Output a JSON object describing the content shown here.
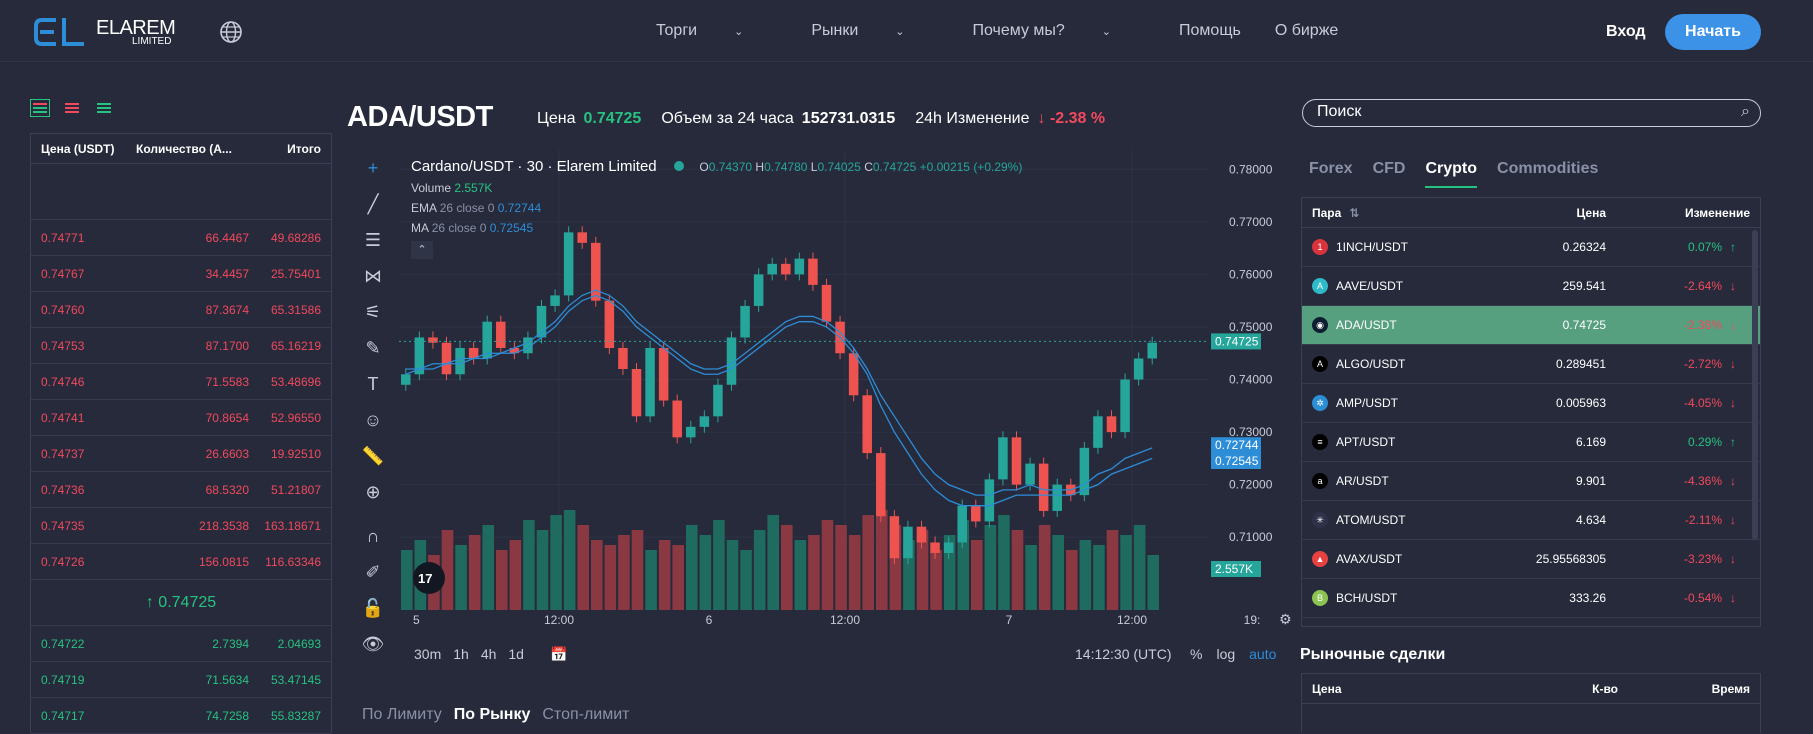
{
  "header": {
    "logo_main": "ELAREM",
    "logo_sub": "LIMITED",
    "nav": [
      "Торги",
      "Рынки",
      "Почему мы?",
      "Помощь",
      "О бирже"
    ],
    "login": "Вход",
    "start": "Начать"
  },
  "orderbook": {
    "headers": [
      "Цена (USDT)",
      "Количество (A...",
      "Итого"
    ],
    "asks": [
      [
        "0.74771",
        "66.4467",
        "49.68286"
      ],
      [
        "0.74767",
        "34.4457",
        "25.75401"
      ],
      [
        "0.74760",
        "87.3674",
        "65.31586"
      ],
      [
        "0.74753",
        "87.1700",
        "65.16219"
      ],
      [
        "0.74746",
        "71.5583",
        "53.48696"
      ],
      [
        "0.74741",
        "70.8654",
        "52.96550"
      ],
      [
        "0.74737",
        "26.6603",
        "19.92510"
      ],
      [
        "0.74736",
        "68.5320",
        "51.21807"
      ],
      [
        "0.74735",
        "218.3538",
        "163.18671"
      ],
      [
        "0.74726",
        "156.0815",
        "116.63346"
      ]
    ],
    "mid_price": "↑ 0.74725",
    "bids": [
      [
        "0.74722",
        "2.7394",
        "2.04693"
      ],
      [
        "0.74719",
        "71.5634",
        "53.47145"
      ],
      [
        "0.74717",
        "74.7258",
        "55.83287"
      ]
    ]
  },
  "ticker": {
    "pair": "ADA/USDT",
    "price_label": "Цена",
    "price": "0.74725",
    "volume_label": "Объем за 24 часа",
    "volume": "152731.0315",
    "change_label": "24h Изменение",
    "change": "↓ -2.38 %"
  },
  "chart_legend": {
    "title": "Cardano/USDT · 30 · Elarem Limited",
    "ohlc": [
      "O",
      "0.74370",
      "H",
      "0.74780",
      "L",
      "0.74025",
      "C",
      "0.74725",
      "+0.00215 (+0.29%)"
    ],
    "volume_label": "Volume",
    "volume_value": "2.557K",
    "ema_label": "EMA",
    "ema_params": "26 close 0",
    "ema_value": "0.72744",
    "ma_label": "MA",
    "ma_params": "26 close 0",
    "ma_value": "0.72545"
  },
  "chart_data": {
    "type": "line",
    "title": "Cardano/USDT · 30 · Elarem Limited",
    "ylim": [
      0.703,
      0.781
    ],
    "y_ticks": [
      "0.78000",
      "0.77000",
      "0.76000",
      "0.75000",
      "0.74000",
      "0.73000",
      "0.72000",
      "0.71000"
    ],
    "x_ticks": [
      "5",
      "12:00",
      "6",
      "12:00",
      "7",
      "12:00",
      "19:"
    ],
    "last_price_label": "0.74725",
    "ema_label": "0.72744",
    "ma_label": "0.72545",
    "volume_label": "2.557K",
    "series": [
      {
        "values": [
          0.741,
          0.748,
          0.747,
          0.741,
          0.746,
          0.744,
          0.751,
          0.746,
          0.745,
          0.748,
          0.754,
          0.756,
          0.768,
          0.766,
          0.755,
          0.746,
          0.742,
          0.733,
          0.746,
          0.736,
          0.729,
          0.731,
          0.733,
          0.739,
          0.748,
          0.754,
          0.76,
          0.762,
          0.76,
          0.763,
          0.758,
          0.751,
          0.745,
          0.737,
          0.726,
          0.714,
          0.706,
          0.712,
          0.709,
          0.707,
          0.709,
          0.716,
          0.713,
          0.721,
          0.729,
          0.72,
          0.724,
          0.715,
          0.72,
          0.718,
          0.727,
          0.733,
          0.73,
          0.74,
          0.744,
          0.747
        ]
      },
      {
        "values": [
          0.742,
          0.742,
          0.743,
          0.743,
          0.744,
          0.744,
          0.745,
          0.745,
          0.746,
          0.747,
          0.749,
          0.751,
          0.754,
          0.756,
          0.757,
          0.756,
          0.754,
          0.751,
          0.749,
          0.747,
          0.745,
          0.743,
          0.742,
          0.742,
          0.743,
          0.745,
          0.747,
          0.749,
          0.751,
          0.752,
          0.752,
          0.751,
          0.749,
          0.746,
          0.742,
          0.737,
          0.733,
          0.729,
          0.725,
          0.722,
          0.72,
          0.719,
          0.718,
          0.718,
          0.719,
          0.719,
          0.72,
          0.719,
          0.719,
          0.719,
          0.72,
          0.722,
          0.723,
          0.725,
          0.726,
          0.727
        ]
      },
      {
        "values": [
          0.741,
          0.742,
          0.742,
          0.743,
          0.743,
          0.744,
          0.744,
          0.745,
          0.745,
          0.746,
          0.748,
          0.75,
          0.753,
          0.755,
          0.756,
          0.755,
          0.753,
          0.75,
          0.748,
          0.746,
          0.744,
          0.742,
          0.741,
          0.741,
          0.742,
          0.744,
          0.746,
          0.748,
          0.75,
          0.751,
          0.751,
          0.75,
          0.748,
          0.745,
          0.741,
          0.735,
          0.73,
          0.726,
          0.722,
          0.719,
          0.717,
          0.716,
          0.716,
          0.716,
          0.717,
          0.718,
          0.718,
          0.718,
          0.718,
          0.718,
          0.719,
          0.72,
          0.722,
          0.723,
          0.724,
          0.725
        ]
      }
    ],
    "volumes": [
      60,
      70,
      55,
      80,
      65,
      75,
      85,
      60,
      70,
      90,
      80,
      95,
      100,
      85,
      70,
      65,
      75,
      80,
      60,
      70,
      65,
      85,
      75,
      90,
      70,
      60,
      80,
      95,
      85,
      70,
      75,
      90,
      85,
      75,
      95,
      100,
      85,
      70,
      80,
      60,
      75,
      90,
      70,
      85,
      95,
      80,
      65,
      85,
      75,
      60,
      70,
      65,
      80,
      75,
      85,
      55
    ],
    "colors": {
      "up": "#26a69a",
      "down": "#ef5350",
      "ema": "#2d8dd6",
      "ma": "#2d8dd6"
    }
  },
  "chart_controls": {
    "intervals": [
      "30m",
      "1h",
      "4h",
      "1d"
    ],
    "time": "14:12:30 (UTC)",
    "percent": "%",
    "log": "log",
    "auto": "auto"
  },
  "order_tabs": [
    "По Лимиту",
    "По Рынку",
    "Стоп-лимит"
  ],
  "market": {
    "search_placeholder": "Поиск",
    "tabs": [
      "Forex",
      "CFD",
      "Crypto",
      "Commodities"
    ],
    "headers": [
      "Пара",
      "Цена",
      "Изменение"
    ],
    "rows": [
      {
        "pair": "1INCH/USDT",
        "price": "0.26324",
        "change": "0.07%",
        "dir": "up",
        "color": "#d9343d",
        "icon": "1"
      },
      {
        "pair": "AAVE/USDT",
        "price": "259.541",
        "change": "-2.64%",
        "dir": "down",
        "color": "#2ebac6",
        "icon": "A"
      },
      {
        "pair": "ADA/USDT",
        "price": "0.74725",
        "change": "-2.38%",
        "dir": "down",
        "color": "#0d1e30",
        "icon": "◉"
      },
      {
        "pair": "ALGO/USDT",
        "price": "0.289451",
        "change": "-2.72%",
        "dir": "down",
        "color": "#000000",
        "icon": "A"
      },
      {
        "pair": "AMP/USDT",
        "price": "0.005963",
        "change": "-4.05%",
        "dir": "down",
        "color": "#2b8fd6",
        "icon": "✲"
      },
      {
        "pair": "APT/USDT",
        "price": "6.169",
        "change": "0.29%",
        "dir": "up",
        "color": "#000000",
        "icon": "≡"
      },
      {
        "pair": "AR/USDT",
        "price": "9.901",
        "change": "-4.36%",
        "dir": "down",
        "color": "#000000",
        "icon": "a"
      },
      {
        "pair": "ATOM/USDT",
        "price": "4.634",
        "change": "-2.11%",
        "dir": "down",
        "color": "#2e3148",
        "icon": "✳"
      },
      {
        "pair": "AVAX/USDT",
        "price": "25.95568305",
        "change": "-3.23%",
        "dir": "down",
        "color": "#e84142",
        "icon": "▲"
      },
      {
        "pair": "BCH/USDT",
        "price": "333.26",
        "change": "-0.54%",
        "dir": "down",
        "color": "#8dc351",
        "icon": "B"
      }
    ]
  },
  "trades": {
    "title": "Рыночные сделки",
    "headers": [
      "Цена",
      "К-во",
      "Время"
    ]
  }
}
